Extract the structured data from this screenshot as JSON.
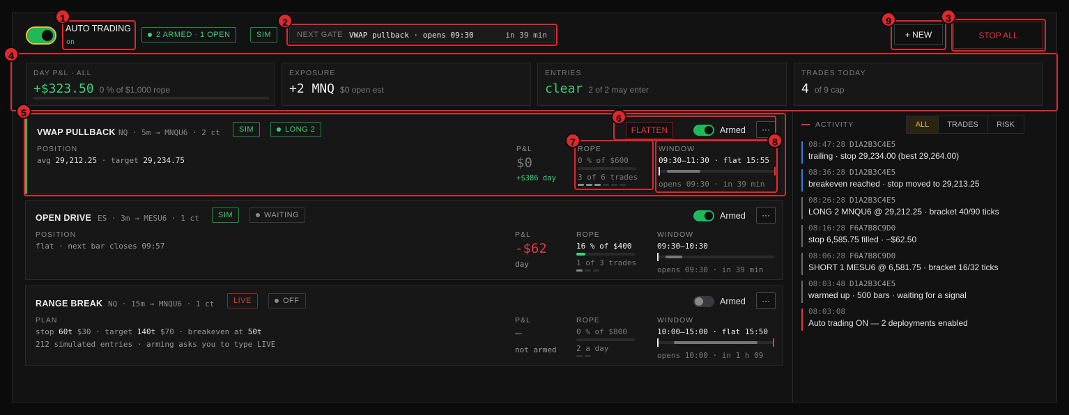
{
  "topbar": {
    "auto_trading_label": "AUTO TRADING",
    "auto_trading_state": "on",
    "armed_status": "2 ARMED · 1 OPEN",
    "mode": "SIM",
    "gate_label": "NEXT GATE",
    "gate_value": "VWAP pullback · opens 09:30",
    "gate_eta": "in 39 min",
    "new_button": "+ NEW",
    "stop_all_button": "STOP ALL"
  },
  "stats": {
    "day_pnl": {
      "label": "DAY P&L · ALL",
      "value": "+$323.50",
      "sub": "0 % of $1,000 rope",
      "fill": 0.0
    },
    "exposure": {
      "label": "EXPOSURE",
      "value": "+2 MNQ",
      "sub": "$0 open est"
    },
    "entries": {
      "label": "ENTRIES",
      "value": "clear",
      "sub": "2 of 2 may enter"
    },
    "trades_today": {
      "label": "TRADES TODAY",
      "value": "4",
      "sub": "of 9 cap"
    }
  },
  "deployments": [
    {
      "name": "VWAP PULLBACK",
      "meta": "NQ · 5m → MNQU6 · 2 ct",
      "mode": "SIM",
      "state": "LONG 2",
      "flatten_label": "FLATTEN",
      "armed_label": "Armed",
      "armed": true,
      "more_label": "···",
      "pos_header": "POSITION",
      "pos_line1_a": "avg",
      "pos_line1_b": "29,212.25",
      "pos_line1_c": "· target",
      "pos_line1_d": "29,234.75",
      "pnl_header": "P&L",
      "pnl_value": "$0",
      "pnl_sub": "+$386 day",
      "rope_header": "ROPE",
      "rope_value": "0 % of $600",
      "rope_fill": 0.0,
      "rope_trades": "3 of 6 trades",
      "window_header": "WINDOW",
      "window_value": "09:30–11:30 · flat 15:55",
      "window_sub": "opens 09:30 · in 39 min"
    },
    {
      "name": "OPEN DRIVE",
      "meta": "ES · 3m → MESU6 · 1 ct",
      "mode": "SIM",
      "state": "WAITING",
      "armed_label": "Armed",
      "armed": true,
      "more_label": "···",
      "pos_header": "POSITION",
      "pos_line1": "flat · next bar closes 09:57",
      "pnl_header": "P&L",
      "pnl_value": "-$62",
      "pnl_sub": "day",
      "rope_header": "ROPE",
      "rope_value": "16 % of $400",
      "rope_fill": 0.16,
      "rope_trades": "1 of 3 trades",
      "window_header": "WINDOW",
      "window_value": "09:30–10:30",
      "window_sub": "opens 09:30 · in 39 min"
    },
    {
      "name": "RANGE BREAK",
      "meta": "NQ · 15m → MNQU6 · 1 ct",
      "mode": "LIVE",
      "state": "OFF",
      "armed_label": "Armed",
      "armed": false,
      "more_label": "···",
      "pos_header": "PLAN",
      "plan_stop": "stop",
      "plan_stop_t": "60t",
      "plan_stop_d": "$30",
      "plan_target": "· target",
      "plan_target_t": "140t",
      "plan_target_d": "$70",
      "plan_be": "· breakeven at",
      "plan_be_t": "50t",
      "pos_line2": "212 simulated entries · arming asks you to type LIVE",
      "pnl_header": "P&L",
      "pnl_value": "—",
      "pnl_sub": "not armed",
      "rope_header": "ROPE",
      "rope_value": "0 % of $800",
      "rope_fill": 0.0,
      "rope_trades": "2 a day",
      "window_header": "WINDOW",
      "window_value": "10:00–15:00 · flat 15:50",
      "window_sub": "opens 10:00 · in 1 h 09"
    }
  ],
  "activity": {
    "title": "ACTIVITY",
    "tabs": [
      "ALL",
      "TRADES",
      "RISK"
    ],
    "selected_tab": "ALL",
    "events": [
      {
        "time": "08:47:28",
        "id": "D1A2B3C4E5",
        "text": "trailing · stop 29,234.00 (best 29,264.00)",
        "color": "#2f7fd6"
      },
      {
        "time": "08:36:28",
        "id": "D1A2B3C4E5",
        "text": "breakeven reached · stop moved to 29,213.25",
        "color": "#2f7fd6"
      },
      {
        "time": "08:26:28",
        "id": "D1A2B3C4E5",
        "text": "LONG 2 MNQU6 @ 29,212.25 · bracket 40/90 ticks",
        "color": "#6a6a6a"
      },
      {
        "time": "08:16:28",
        "id": "F6A7B8C9D0",
        "text": "stop 6,585.75 filled · −$62.50",
        "color": "#6a6a6a"
      },
      {
        "time": "08:06:28",
        "id": "F6A7B8C9D0",
        "text": "SHORT 1 MESU6 @ 6,581.75 · bracket 16/32 ticks",
        "color": "#6a6a6a"
      },
      {
        "time": "08:03:48",
        "id": "D1A2B3C4E5",
        "text": "warmed up · 500 bars · waiting for a signal",
        "color": "#6a6a6a"
      },
      {
        "time": "08:03:08",
        "id": "",
        "text": "Auto trading ON — 2 deployments enabled",
        "color": "#e0383d"
      }
    ]
  },
  "annotations": [
    "1",
    "2",
    "3",
    "4",
    "5",
    "6",
    "7",
    "8",
    "9"
  ]
}
